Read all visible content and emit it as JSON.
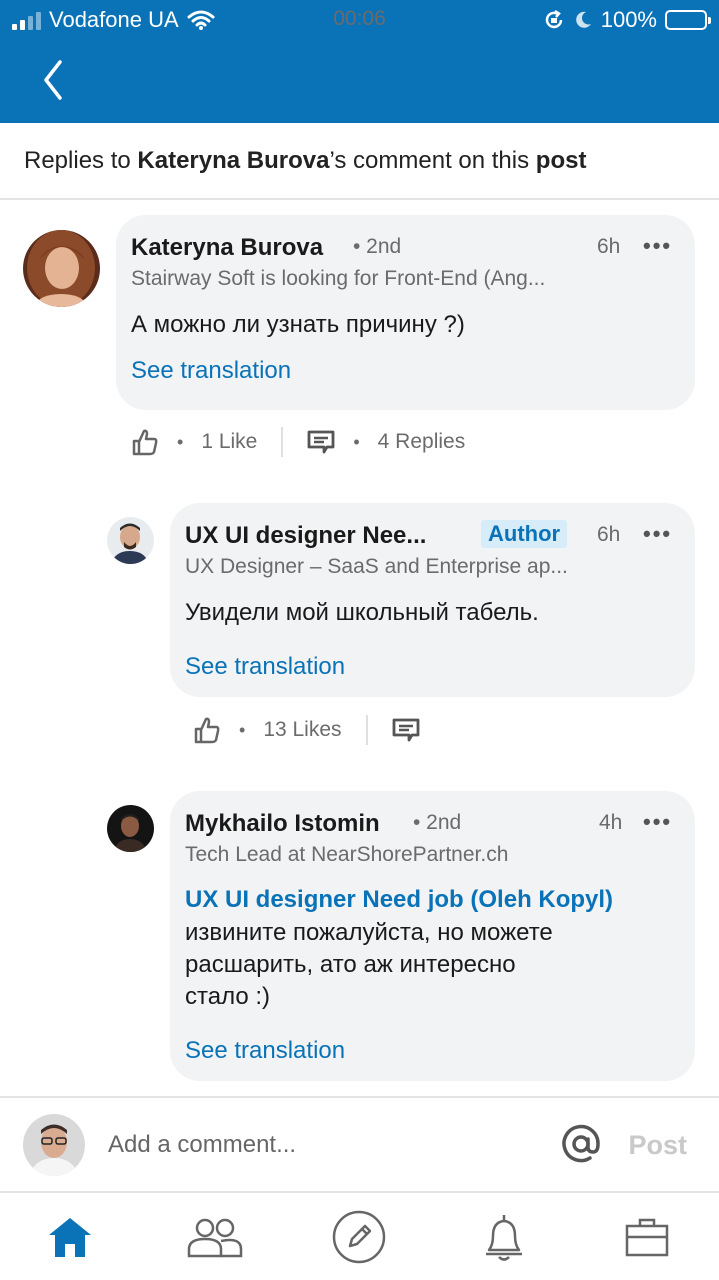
{
  "status_bar": {
    "carrier": "Vodafone UA",
    "time": "00:06",
    "battery": "100%"
  },
  "header": {
    "prefix": "Replies to ",
    "author": "Kateryna Burova",
    "middle": "’s comment on this ",
    "post": "post"
  },
  "comments": [
    {
      "name": "Kateryna Burova",
      "degree": "• 2nd",
      "time": "6h",
      "headline": "Stairway Soft is looking for Front-End (Ang...",
      "text": "А можно ли узнать причину ?)",
      "see_translation": "See translation",
      "likes": "1 Like",
      "replies": "4 Replies"
    },
    {
      "name": "UX UI designer Nee...",
      "badge": "Author",
      "time": "6h",
      "headline": "UX Designer – SaaS and Enterprise ap...",
      "text": "Увидели мой школьный табель.",
      "see_translation": "See translation",
      "likes": "13 Likes"
    },
    {
      "name": "Mykhailo Istomin",
      "degree": "• 2nd",
      "time": "4h",
      "headline": "Tech Lead at NearShorePartner.ch",
      "mention": "UX UI designer Need job (Oleh Kopyl)",
      "text_lines": [
        "извините пожалуйста, но можете",
        "расшарить, ато аж интересно",
        "стало :)"
      ],
      "see_translation": "See translation"
    }
  ],
  "composer": {
    "placeholder": "Add a comment...",
    "post_label": "Post"
  },
  "nav": [
    "home-icon",
    "my-network-icon",
    "post-icon",
    "notifications-icon",
    "jobs-icon"
  ],
  "colors": {
    "brand": "#0a73b8",
    "bubble": "#f1f3f4",
    "badge_bg": "#d7ecf9"
  }
}
